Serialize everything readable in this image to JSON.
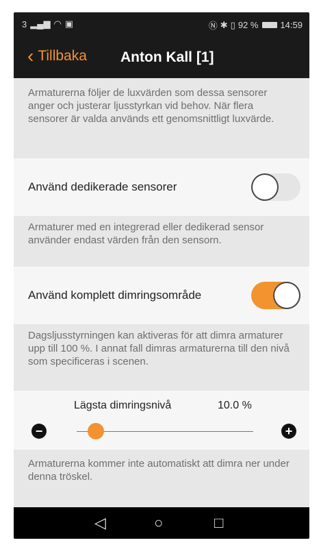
{
  "status_bar": {
    "left_text": "3",
    "battery_percent": "92 %",
    "time": "14:59"
  },
  "nav": {
    "back_label": "Tillbaka",
    "title": "Anton Kall [1]"
  },
  "descriptions": {
    "top": "Armaturerna följer de luxvärden som dessa sensorer anger och justerar ljusstyrkan vid behov. När flera sensorer är valda används ett genomsnittligt luxvärde.",
    "dedicated": "Armaturer med en integrerad eller dedikerad sensor använder endast värden från den sensorn.",
    "full_dimming": "Dagsljusstyrningen kan aktiveras för att dimra armaturer upp till 100 %. I annat fall dimras armaturerna till den nivå som specificeras i scenen.",
    "threshold": "Armaturerna kommer inte automatiskt att dimra ner under denna tröskel."
  },
  "settings": {
    "dedicated_sensors": {
      "label": "Använd dedikerade sensorer",
      "enabled": false
    },
    "full_dimming_range": {
      "label": "Använd komplett dimringsområde",
      "enabled": true
    }
  },
  "slider": {
    "label": "Lägsta dimringsnivå",
    "value_text": "10.0 %",
    "value_fraction": 0.1
  },
  "colors": {
    "accent": "#f39330",
    "bar": "#1a1a1a"
  },
  "icons": {
    "back": "chevron-left-icon",
    "minus": "minus-circle-icon",
    "plus": "plus-circle-icon"
  }
}
